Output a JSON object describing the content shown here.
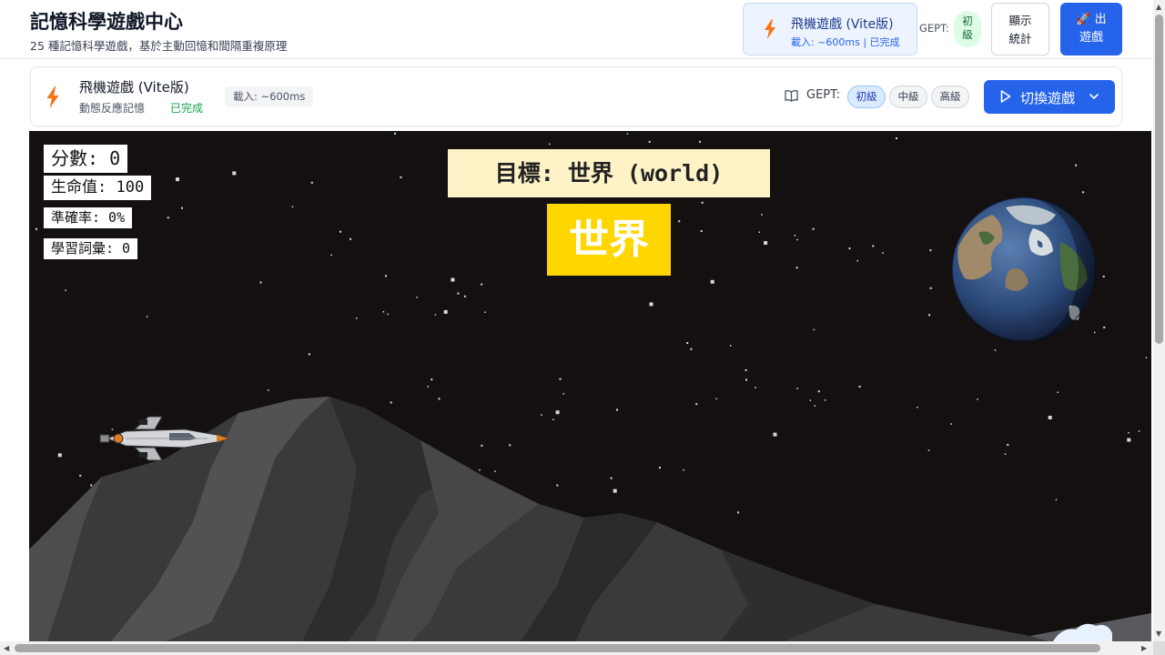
{
  "header": {
    "title": "記憶科學遊戲中心",
    "subtitle": "25 種記憶科學遊戲，基於主動回憶和間隔重複原理",
    "current_game": {
      "name": "飛機遊戲 (Vite版)",
      "meta": "載入: ~600ms | 已完成",
      "icon": "lightning-icon"
    },
    "gept_label": "GEPT:",
    "gept_level_line1": "初",
    "gept_level_line2": "級",
    "stats_button_line1": "顯示",
    "stats_button_line2": "統計",
    "exit_button_line1": "🚀 出",
    "exit_button_line2": "遊戲"
  },
  "info_bar": {
    "game_name": "飛機遊戲 (Vite版)",
    "category": "動態反應記憶",
    "status": "已完成",
    "load_time": "載入: ~600ms",
    "gept_label": "GEPT:",
    "levels": [
      "初級",
      "中級",
      "高級"
    ],
    "active_level": "初級",
    "switch_button": "切換遊戲",
    "colors": {
      "accent": "#2563eb",
      "done": "#16a34a",
      "bolt": "#f97316"
    }
  },
  "game": {
    "score_label": "分數: 0",
    "hp_label": "生命值: 100",
    "accuracy_label": "準確率: 0%",
    "words_label": "學習詞彙: 0",
    "target_label": "目標: 世界 (world)",
    "target_word": "世界",
    "colors": {
      "sky": "#141010",
      "target_bg": "#fdf3c7",
      "word_bg": "#ffd600"
    }
  }
}
